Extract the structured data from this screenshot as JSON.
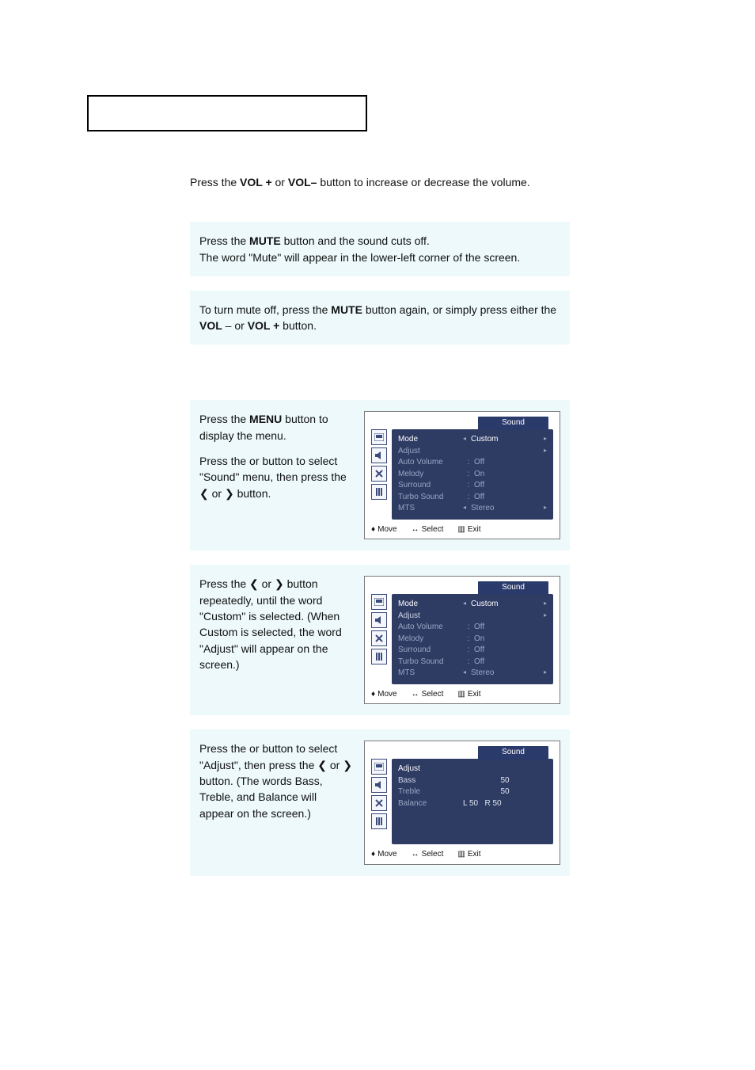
{
  "title_box": "",
  "vol_line_pre": "Press the ",
  "vol_plus": "VOL +",
  "vol_line_mid": " or ",
  "vol_minus": "VOL–",
  "vol_line_post": " button to increase or decrease the volume.",
  "mute1_pre": "Press the ",
  "mute_btn": "MUTE",
  "mute1_post": " button and the sound cuts off.",
  "mute1_line2": "The word \"Mute\" will appear in the lower-left corner of the screen.",
  "mute2_pre": "To turn mute off, press the ",
  "mute2_post": " button again, or simply press either the ",
  "vol_minus_sp": "VOL",
  "dash_sp": " –   or ",
  "vol_plus_sp": "VOL +",
  "mute2_end": " button.",
  "step1a_pre": "Press the ",
  "menu_btn": "MENU",
  "step1a_post": " button to display the menu.",
  "step1b": "Press the     or      button to select  \"Sound\" menu, then press the  ❮  or  ❯  button.",
  "step2": "Press the  ❮  or  ❯   button repeatedly, until the word \"Custom\" is selected. (When Custom is selected, the word \"Adjust\" will appear on the screen.)",
  "step3": "Press the     or      button to select \"Adjust\", then press the  ❮  or  ❯   button. (The words Bass, Treble, and Balance will appear on the screen.)",
  "osd": {
    "title": "Sound",
    "rows": {
      "mode": {
        "label": "Mode",
        "value": "Custom"
      },
      "adjust": {
        "label": "Adjust",
        "value": ""
      },
      "auto_volume": {
        "label": "Auto Volume",
        "value": "Off"
      },
      "melody": {
        "label": "Melody",
        "value": "On"
      },
      "surround": {
        "label": "Surround",
        "value": "Off"
      },
      "turbo": {
        "label": "Turbo Sound",
        "value": "Off"
      },
      "mts": {
        "label": "MTS",
        "value": "Stereo"
      }
    },
    "footer": {
      "move": "Move",
      "select": "Select",
      "exit": "Exit"
    }
  },
  "osd_adjust": {
    "title": "Sound",
    "heading": "Adjust",
    "bass": {
      "label": "Bass",
      "value": "50"
    },
    "treble": {
      "label": "Treble",
      "value": "50"
    },
    "balance": {
      "label": "Balance",
      "left": "L  50",
      "right": "R  50"
    }
  }
}
